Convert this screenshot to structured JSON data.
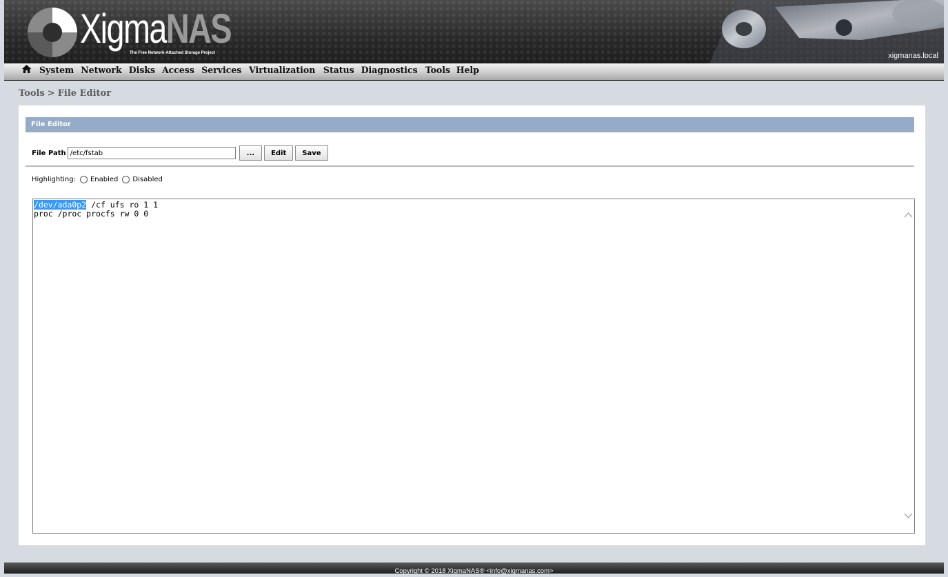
{
  "header": {
    "logo_text_main": "Xigma",
    "logo_text_accent": "NAS",
    "tagline": "The Free Network-Attached Storage Project",
    "hostname": "xigmanas.local"
  },
  "menu": {
    "items": [
      "System",
      "Network",
      "Disks",
      "Access",
      "Services",
      "Virtualization",
      "Status",
      "Diagnostics",
      "Tools",
      "Help"
    ]
  },
  "breadcrumb": {
    "parent": "Tools",
    "separator": ">",
    "current": "File Editor"
  },
  "panel": {
    "title": "File Editor",
    "file_path_label": "File Path",
    "file_path_value": "/etc/fstab",
    "browse_label": "...",
    "edit_label": "Edit",
    "save_label": "Save",
    "highlighting_label": "Highlighting:",
    "enabled_label": "Enabled",
    "disabled_label": "Disabled"
  },
  "editor": {
    "line1_selected": "/dev/ada0p2",
    "line1_rest": " /cf ufs ro 1 1",
    "line2": "proc /proc procfs rw 0 0"
  },
  "footer": {
    "text": "Copyright © 2018 XigmaNAS® <info@xigmanas.com>"
  },
  "colors": {
    "panel_header": "#95abc7",
    "selection": "#3399ff",
    "page_background": "#d6dbe1"
  }
}
